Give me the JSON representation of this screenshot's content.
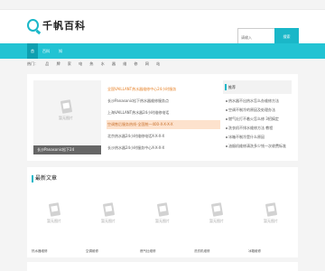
{
  "topbar": {
    "left": "",
    "right": ""
  },
  "brand": {
    "name": "千帆百科"
  },
  "search": {
    "placeholder": "请输入",
    "button": "搜索"
  },
  "nav": {
    "items": [
      "首",
      "百科",
      "知",
      "",
      ""
    ]
  },
  "hotbar": {
    "label": "热门：",
    "items": [
      "品",
      "牌",
      "家",
      "电",
      "热",
      "水",
      "器",
      "维",
      "修",
      "网",
      "站"
    ]
  },
  "featured": {
    "placeholder_label": "暂无图片",
    "caption": "长沙Panasonic松下24"
  },
  "headlines": [
    "全国VAILLANT热水器维修中心24小时服务",
    "长沙Panasonic松下热水器维修服务点",
    "上海VAILLANT热水器24小时维修电话",
    "空调售后服务热线-全国统一400-X-X-X-X",
    "北京热水器24小时维修电话X-X-X-X",
    "长沙热水器24小时服务中心X-X-X-X"
  ],
  "side": {
    "title": "推荐",
    "items": [
      "热水器不出热水怎么办维修方法",
      "空调不制冷的原因及处理办法",
      "燃气灶打不着火怎么修 3招搞定",
      "洗衣机不排水维修方法 教程",
      "冰箱不制冷是什么原因",
      "油烟机维修清洗多少钱一次收费标准"
    ]
  },
  "panel": {
    "title": "最新文章",
    "cards": [
      {
        "label": "暂无图片",
        "caption": "热水器维修"
      },
      {
        "label": "暂无图片",
        "caption": "空调维修"
      },
      {
        "label": "暂无图片",
        "caption": "燃气灶维修"
      },
      {
        "label": "暂无图片",
        "caption": "洗衣机维修"
      },
      {
        "label": "暂无图片",
        "caption": "冰箱维修"
      }
    ]
  },
  "colors": {
    "accent": "#22c3d3",
    "accent_dark": "#0e9fb0",
    "highlight": "#fde2cd",
    "orange": "#e67e22"
  }
}
